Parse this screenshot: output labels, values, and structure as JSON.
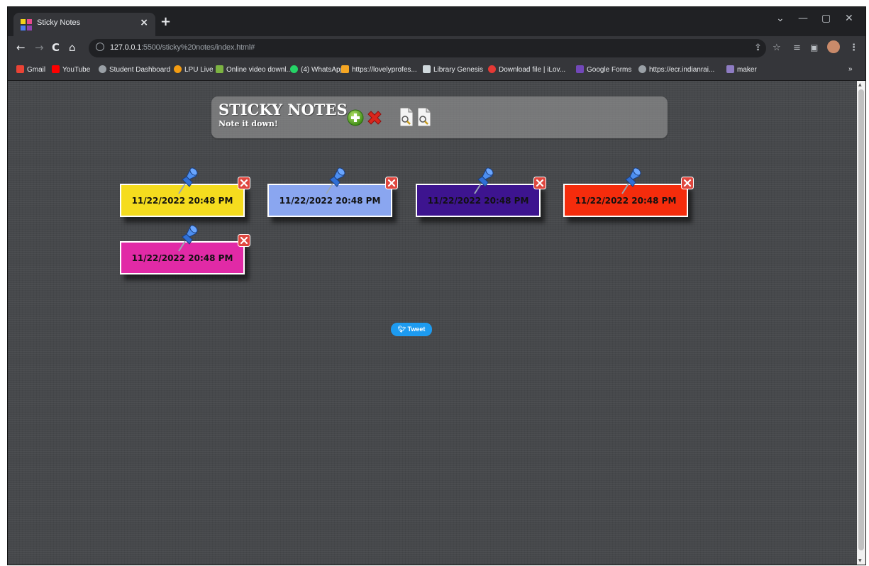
{
  "browser": {
    "tab_title": "Sticky Notes",
    "tab_close": "×",
    "new_tab": "+",
    "url_host": "127.0.0.1",
    "url_rest": ":5500/sticky%20notes/index.html#",
    "window_controls": [
      "⌄",
      "—",
      "▢",
      "✕"
    ]
  },
  "bookmarks": [
    {
      "label": "Gmail",
      "color": "#ea4335"
    },
    {
      "label": "YouTube",
      "color": "#ff0000"
    },
    {
      "label": "Student Dashboard",
      "color": "#9aa0a6"
    },
    {
      "label": "LPU Live",
      "color": "#f39c12"
    },
    {
      "label": "Online video downl...",
      "color": "#7cb342"
    },
    {
      "label": "(4) WhatsApp",
      "color": "#25d366"
    },
    {
      "label": "https://lovelyprofes...",
      "color": "#f5a623"
    },
    {
      "label": "Library Genesis",
      "color": "#cfd8dc"
    },
    {
      "label": "Download file | iLov...",
      "color": "#e53935"
    },
    {
      "label": "Google Forms",
      "color": "#7248b9"
    },
    {
      "label": "https://ecr.indianrai...",
      "color": "#9aa0a6"
    },
    {
      "label": "maker",
      "color": "#8e7cc3"
    }
  ],
  "bookmarks_overflow": "»",
  "header": {
    "title": "STICKY NOTES",
    "subtitle": "Note it down!"
  },
  "notes": [
    {
      "date": "11/22/2022 20:48 PM",
      "color": "#f5dc1e"
    },
    {
      "date": "11/22/2022 20:48 PM",
      "color": "#8aa6f0"
    },
    {
      "date": "11/22/2022 20:48 PM",
      "color": "#3d148f"
    },
    {
      "date": "11/22/2022 20:48 PM",
      "color": "#f52c0c"
    },
    {
      "date": "11/22/2022 20:48 PM",
      "color": "#e12aa6"
    }
  ],
  "tweet": {
    "label": "Tweet"
  }
}
